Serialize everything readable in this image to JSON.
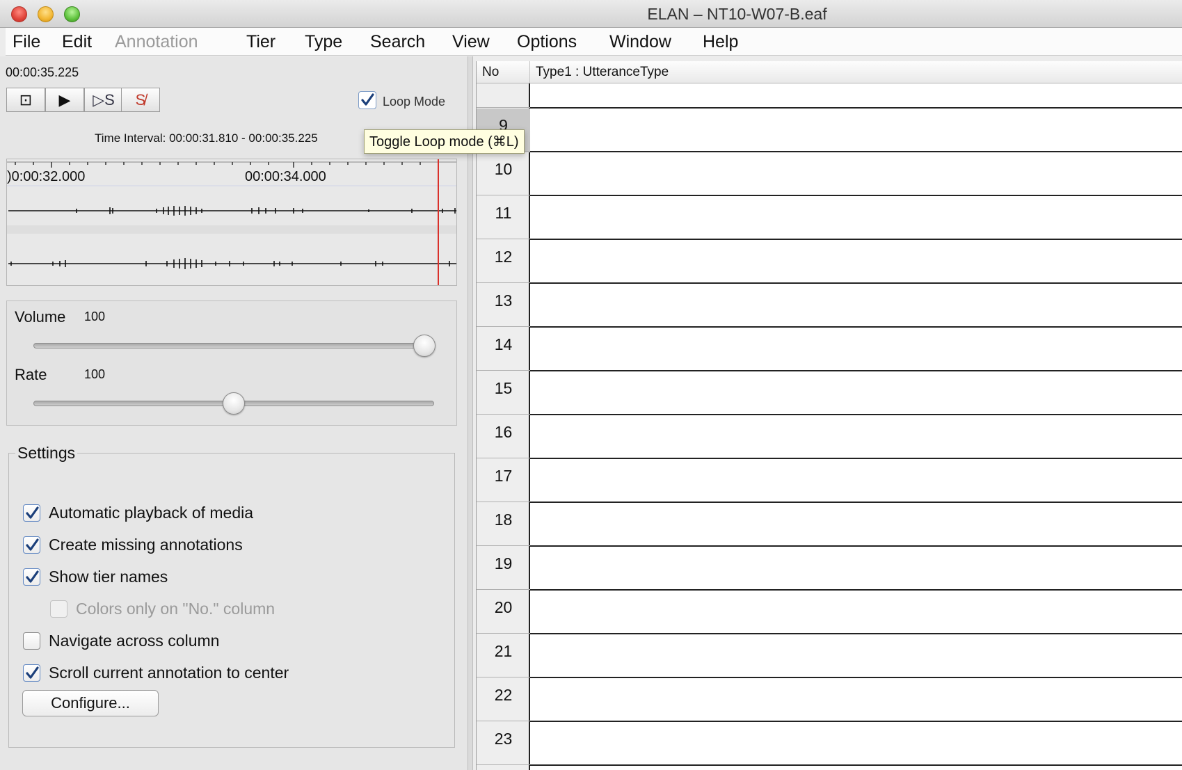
{
  "window": {
    "title": "ELAN – NT10-W07-B.eaf"
  },
  "menu": [
    "File",
    "Edit",
    "Annotation",
    "Tier",
    "Type",
    "Search",
    "View",
    "Options",
    "Window",
    "Help"
  ],
  "player": {
    "current_time": "00:00:35.225",
    "loop_mode_label": "Loop Mode",
    "loop_mode_checked": true,
    "time_interval": "Time Interval: 00:00:31.810 - 00:00:35.225",
    "tooltip": "Toggle Loop mode (⌘L)",
    "buttons": [
      "select-segment-icon",
      "play-icon",
      "play-selection-icon",
      "clear-selection-icon"
    ],
    "button_glyphs": [
      "⊡",
      "▶",
      "▷S",
      "S̸"
    ],
    "wave_labels": [
      ")0:00:32.000",
      "00:00:34.000"
    ]
  },
  "volume": {
    "label": "Volume",
    "value": "100",
    "level": 1.0
  },
  "rate": {
    "label": "Rate",
    "value": "100",
    "level": 0.5
  },
  "settings": {
    "title": "Settings",
    "options": [
      {
        "label": "Automatic playback of media",
        "checked": true,
        "enabled": true
      },
      {
        "label": "Create missing annotations",
        "checked": true,
        "enabled": true
      },
      {
        "label": "Show tier names",
        "checked": true,
        "enabled": true
      },
      {
        "label": "Colors only on \"No.\" column",
        "checked": false,
        "enabled": false
      },
      {
        "label": "Navigate across column",
        "checked": false,
        "enabled": true
      },
      {
        "label": "Scroll current annotation to center",
        "checked": true,
        "enabled": true
      }
    ],
    "configure_label": "Configure..."
  },
  "table": {
    "headers": [
      "No",
      "Type1 : UtteranceType"
    ],
    "rows": [
      "9",
      "10",
      "11",
      "12",
      "13",
      "14",
      "15",
      "16",
      "17",
      "18",
      "19",
      "20",
      "21",
      "22",
      "23"
    ],
    "selected_row": "9"
  }
}
